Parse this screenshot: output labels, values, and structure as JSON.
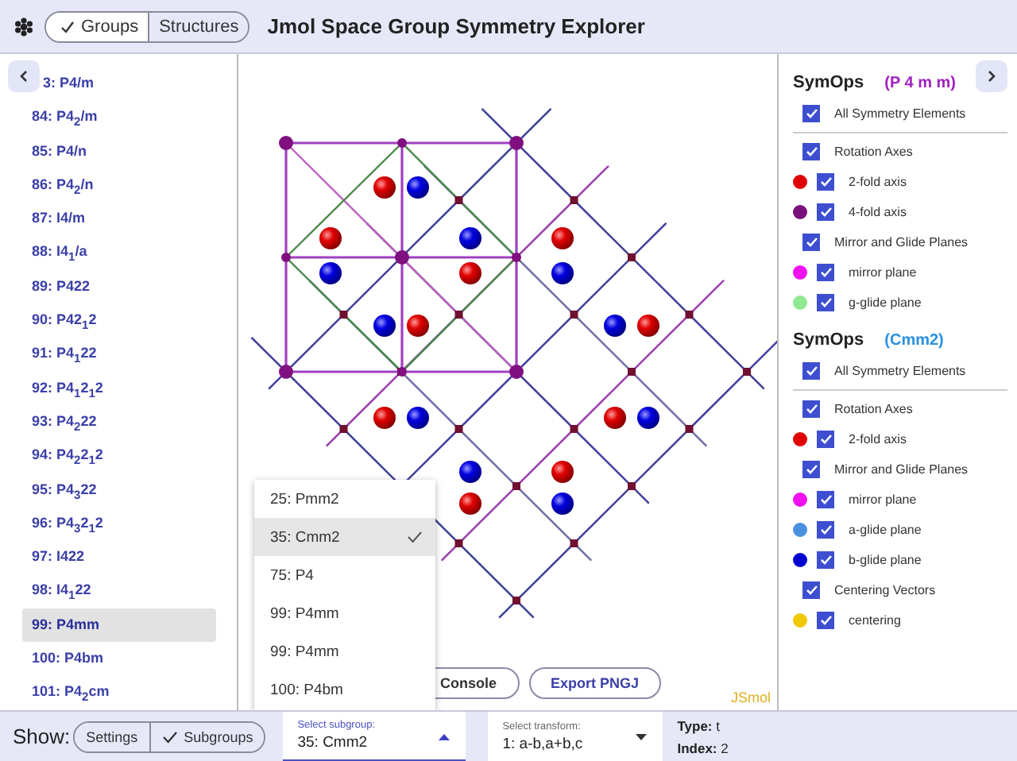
{
  "header": {
    "title": "Jmol Space Group Symmetry Explorer",
    "modes": [
      {
        "label": "Groups",
        "selected": true
      },
      {
        "label": "Structures",
        "selected": false
      }
    ]
  },
  "group_list": {
    "items": [
      {
        "label": "3: P4/m",
        "selected": false
      },
      {
        "label": "84: P4$_{2}$/m",
        "selected": false
      },
      {
        "label": "85: P4/n",
        "selected": false
      },
      {
        "label": "86: P4$_{2}$/n",
        "selected": false
      },
      {
        "label": "87: I4/m",
        "selected": false
      },
      {
        "label": "88: I4$_{1}$/a",
        "selected": false
      },
      {
        "label": "89: P422",
        "selected": false
      },
      {
        "label": "90: P42$_{1}$2",
        "selected": false
      },
      {
        "label": "91: P4$_{1}$22",
        "selected": false
      },
      {
        "label": "92: P4$_{1}$2$_{1}$2",
        "selected": false
      },
      {
        "label": "93: P4$_{2}$22",
        "selected": false
      },
      {
        "label": "94: P4$_{2}$2$_{1}$2",
        "selected": false
      },
      {
        "label": "95: P4$_{3}$22",
        "selected": false
      },
      {
        "label": "96: P4$_{3}$2$_{1}$2",
        "selected": false
      },
      {
        "label": "97: I422",
        "selected": false
      },
      {
        "label": "98: I4$_{1}$22",
        "selected": false
      },
      {
        "label": "99: P4mm",
        "selected": true
      },
      {
        "label": "100: P4bm",
        "selected": false
      },
      {
        "label": "101: P4$_{2}$cm",
        "selected": false
      }
    ]
  },
  "viewer": {
    "menu": {
      "items": [
        {
          "label": "25: Pmm2",
          "selected": false
        },
        {
          "label": "35: Cmm2",
          "selected": true
        },
        {
          "label": "75: P4",
          "selected": false
        },
        {
          "label": "99: P4mm",
          "selected": false
        },
        {
          "label": "99: P4mm",
          "selected": false
        },
        {
          "label": "100: P4bm",
          "selected": false
        }
      ]
    },
    "buttons": [
      "Console",
      "Export PNGJ"
    ],
    "logo": "JSmol"
  },
  "symops": [
    {
      "title": "SymOps",
      "group": "(P 4 m m)",
      "color": "#a020c0",
      "rows": [
        {
          "kind": "all",
          "label": "All Symmetry Elements",
          "checked": true
        },
        {
          "kind": "category",
          "label": "Rotation Axes",
          "checked": true
        },
        {
          "kind": "element",
          "label": "2-fold axis",
          "checked": true,
          "color": "#e00000"
        },
        {
          "kind": "element",
          "label": "4-fold axis",
          "checked": true,
          "color": "#7a107a"
        },
        {
          "kind": "category",
          "label": "Mirror and Glide Planes",
          "checked": true
        },
        {
          "kind": "element",
          "label": "mirror plane",
          "checked": true,
          "color": "#f010f0"
        },
        {
          "kind": "element",
          "label": "g-glide plane",
          "checked": true,
          "color": "#90e890"
        }
      ]
    },
    {
      "title": "SymOps",
      "group": "(Cmm2)",
      "color": "#2a90e0",
      "rows": [
        {
          "kind": "all",
          "label": "All Symmetry Elements",
          "checked": true
        },
        {
          "kind": "category",
          "label": "Rotation Axes",
          "checked": true
        },
        {
          "kind": "element",
          "label": "2-fold axis",
          "checked": true,
          "color": "#e00000"
        },
        {
          "kind": "category",
          "label": "Mirror and Glide Planes",
          "checked": true
        },
        {
          "kind": "element",
          "label": "mirror plane",
          "checked": true,
          "color": "#f010f0"
        },
        {
          "kind": "element",
          "label": "a-glide plane",
          "checked": true,
          "color": "#4a90e0"
        },
        {
          "kind": "element",
          "label": "b-glide plane",
          "checked": true,
          "color": "#0000d0"
        },
        {
          "kind": "category",
          "label": "Centering Vectors",
          "checked": true
        },
        {
          "kind": "element",
          "label": "centering",
          "checked": true,
          "color": "#f0c800"
        }
      ]
    }
  ],
  "bottom_bar": {
    "show_label": "Show:",
    "show_toggles": [
      {
        "label": "Settings",
        "selected": false
      },
      {
        "label": "Subgroups",
        "selected": true
      }
    ],
    "subgroup_select": {
      "label": "Select subgroup:",
      "value": "35: Cmm2",
      "expanded": true
    },
    "transform_select": {
      "label": "Select transform:",
      "value": "1: a-b,a+b,c",
      "expanded": false
    },
    "info": [
      {
        "label": "Type:",
        "value": "t"
      },
      {
        "label": "Index:",
        "value": "2"
      }
    ]
  }
}
